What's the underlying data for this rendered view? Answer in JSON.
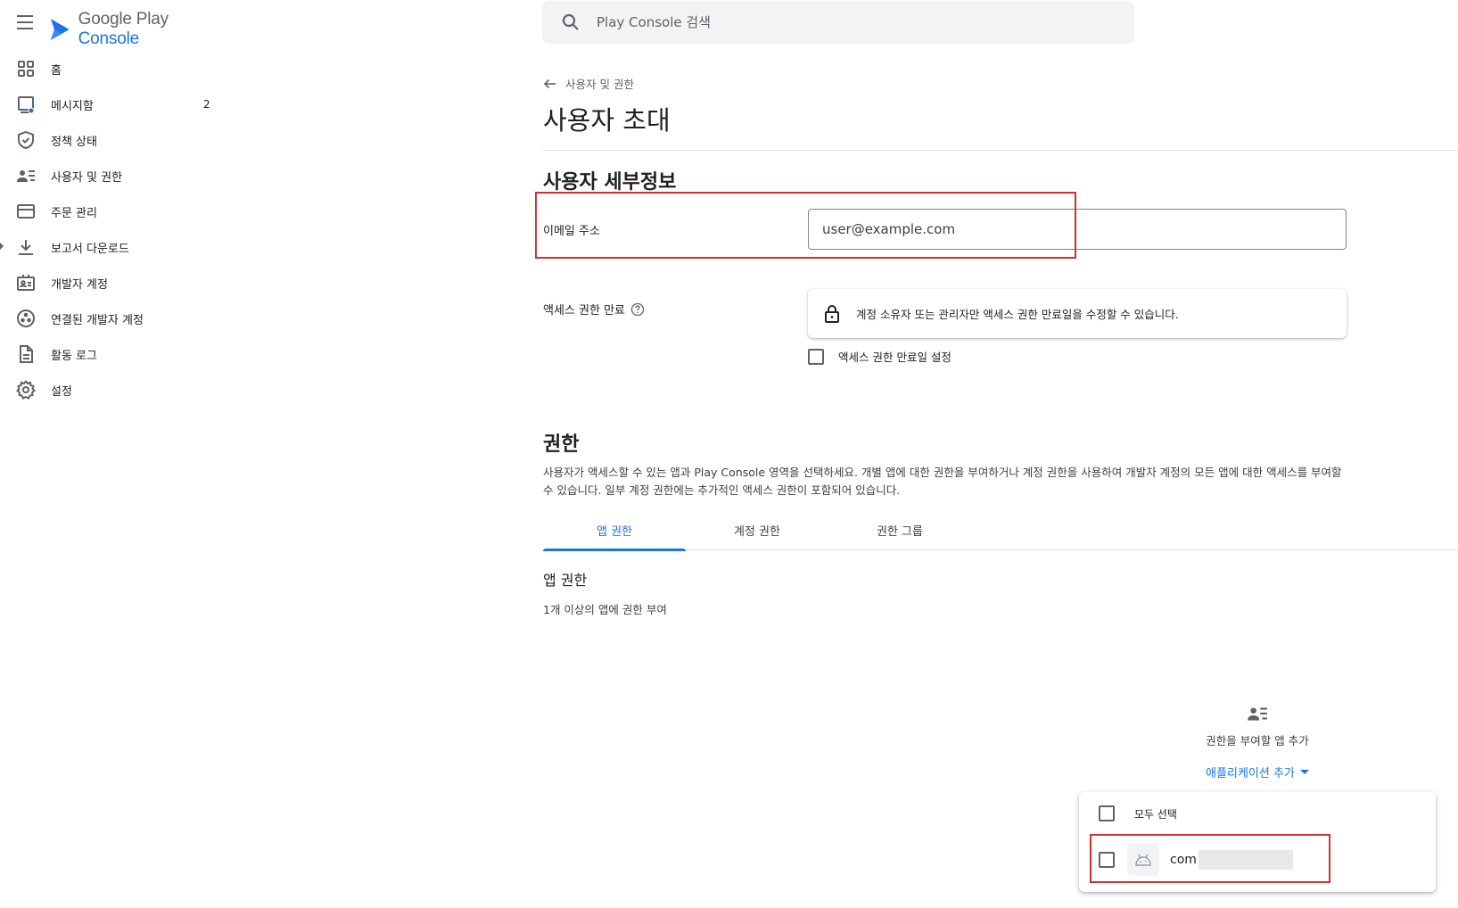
{
  "app": {
    "name_part1": "Google Play",
    "name_part2": "Console"
  },
  "search": {
    "placeholder": "Play Console 검색"
  },
  "sidebar": {
    "items": [
      {
        "label": "홈",
        "icon": "dashboard-grid-icon"
      },
      {
        "label": "메시지함",
        "icon": "inbox-icon",
        "count": "2"
      },
      {
        "label": "정책 상태",
        "icon": "shield-check-icon"
      },
      {
        "label": "사용자 및 권한",
        "icon": "user-list-icon"
      },
      {
        "label": "주문 관리",
        "icon": "credit-card-icon"
      },
      {
        "label": "보고서 다운로드",
        "icon": "download-icon"
      },
      {
        "label": "개발자 계정",
        "icon": "badge-icon"
      },
      {
        "label": "연결된 개발자 계정",
        "icon": "linked-accounts-icon"
      },
      {
        "label": "활동 로그",
        "icon": "document-icon"
      },
      {
        "label": "설정",
        "icon": "gear-icon"
      }
    ]
  },
  "breadcrumb": {
    "back_label": "사용자 및 권한"
  },
  "page": {
    "title": "사용자 초대"
  },
  "details": {
    "section_title": "사용자 세부정보",
    "email_label": "이메일 주소",
    "email_value": "user@example.com",
    "access_expiry_label": "액세스 권한 만료",
    "notice_text": "계정 소유자 또는 관리자만 액세스 권한 만료일을 수정할 수 있습니다.",
    "set_expiry_label": "액세스 권한 만료일 설정"
  },
  "permissions": {
    "title": "권한",
    "description": "사용자가 액세스할 수 있는 앱과 Play Console 영역을 선택하세요. 개별 앱에 대한 권한을 부여하거나 계정 권한을 사용하여 개발자 계정의 모든 앱에 대한 액세스를 부여할 수 있습니다. 일부 계정 권한에는 추가적인 액세스 권한이 포함되어 있습니다.",
    "tabs": [
      {
        "label": "앱 권한",
        "active": true
      },
      {
        "label": "계정 권한",
        "active": false
      },
      {
        "label": "권한 그룹",
        "active": false
      }
    ],
    "app_section_title": "앱 권한",
    "app_section_sub": "1개 이상의 앱에 권한 부여",
    "add_prompt": "권한을 부여할 앱 추가",
    "add_button": "애플리케이션 추가"
  },
  "dropdown": {
    "select_all_label": "모두 선택",
    "app_name": "com"
  },
  "colors": {
    "accent": "#1a73e8",
    "highlight": "#d32f2f"
  }
}
